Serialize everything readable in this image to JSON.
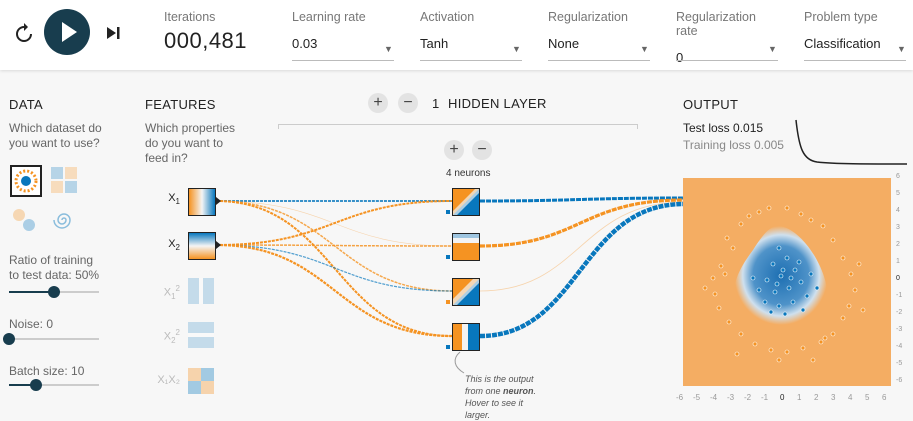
{
  "controls": {
    "reset_icon": "reset-icon",
    "play_icon": "play-icon",
    "step_icon": "step-icon"
  },
  "fields": {
    "iterations": {
      "label": "Iterations",
      "value": "000,481"
    },
    "learning_rate": {
      "label": "Learning rate",
      "value": "0.03"
    },
    "activation": {
      "label": "Activation",
      "value": "Tanh"
    },
    "regularization": {
      "label": "Regularization",
      "value": "None"
    },
    "regularization_rate": {
      "label": "Regularization rate",
      "value": "0"
    },
    "problem_type": {
      "label": "Problem type",
      "value": "Classification"
    }
  },
  "data_panel": {
    "title": "DATA",
    "question": "Which dataset do you want to use?",
    "ratio_label": "Ratio of training to test data:",
    "ratio_value": "50%",
    "ratio_fraction": 0.5,
    "noise_label": "Noise:",
    "noise_value": "0",
    "noise_fraction": 0,
    "batch_label": "Batch size:",
    "batch_value": "10",
    "batch_fraction": 0.3
  },
  "features_panel": {
    "title": "FEATURES",
    "question": "Which properties do you want to feed in?",
    "features": [
      {
        "name": "X",
        "sub": "1",
        "sup": "",
        "active": true
      },
      {
        "name": "X",
        "sub": "2",
        "sup": "",
        "active": true
      },
      {
        "name": "X",
        "sub": "1",
        "sup": "2",
        "active": false
      },
      {
        "name": "X",
        "sub": "2",
        "sup": "2",
        "active": false
      },
      {
        "name": "X₁X₂",
        "sub": "",
        "sup": "",
        "active": false
      }
    ]
  },
  "hidden_layers": {
    "plus": "+",
    "minus": "−",
    "count": "1",
    "label": "HIDDEN LAYER",
    "neurons_label": "4 neurons",
    "tooltip_a": "This is the output",
    "tooltip_b": "from one",
    "tooltip_bold": "neuron",
    "tooltip_c": ". Hover to see it",
    "tooltip_d": "larger."
  },
  "output_panel": {
    "title": "OUTPUT",
    "test_loss_label": "Test loss",
    "test_loss_value": "0.015",
    "training_loss_label": "Training loss",
    "training_loss_value": "0.005",
    "x_ticks": [
      "-6",
      "-5",
      "-4",
      "-3",
      "-2",
      "-1",
      "0",
      "1",
      "2",
      "3",
      "4",
      "5",
      "6"
    ],
    "y_ticks": [
      "6",
      "5",
      "4",
      "3",
      "2",
      "1",
      "0",
      "-1",
      "-2",
      "-3",
      "-4",
      "-5",
      "-6"
    ]
  },
  "colors": {
    "orange": "#f59322",
    "blue": "#0877bd",
    "dark": "#183d4e"
  }
}
